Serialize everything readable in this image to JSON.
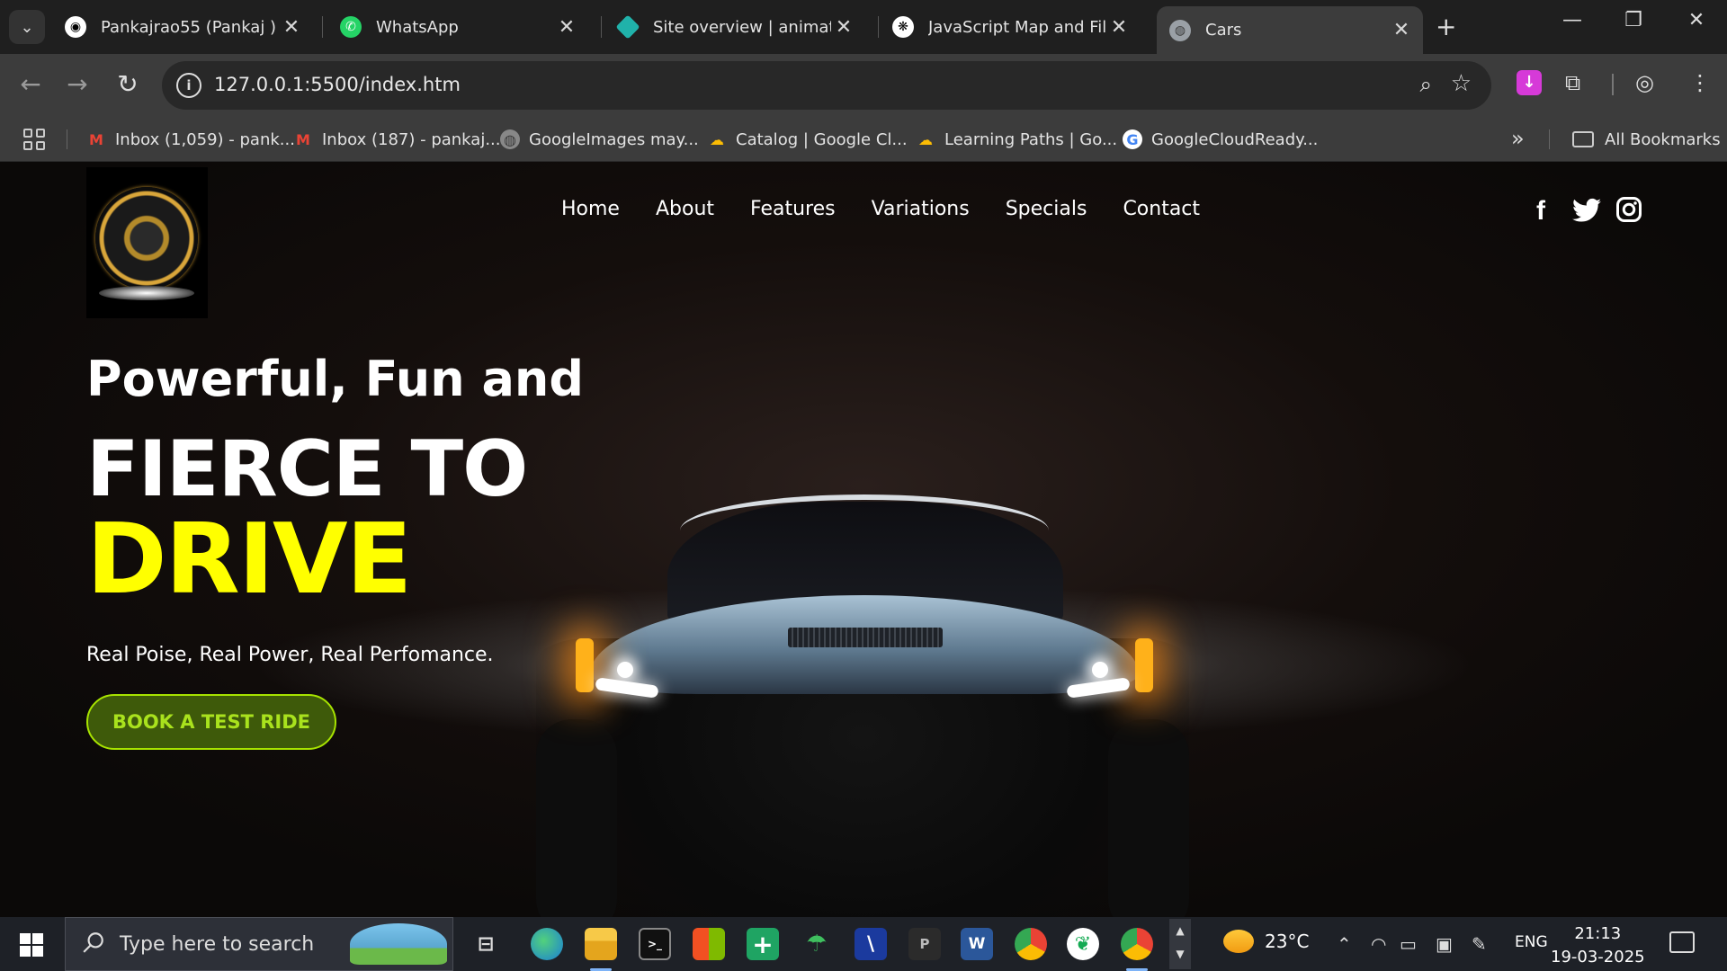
{
  "browser": {
    "tabs": [
      {
        "title": "Pankajrao55 (Pankaj )",
        "icon": "github-icon"
      },
      {
        "title": "WhatsApp",
        "icon": "whatsapp-icon"
      },
      {
        "title": "Site overview | animated-",
        "icon": "netlify-icon"
      },
      {
        "title": "JavaScript Map and Filter",
        "icon": "chatgpt-icon"
      },
      {
        "title": "Cars",
        "icon": "globe-icon",
        "active": true
      }
    ],
    "url": "127.0.0.1:5500/index.htm",
    "bookmarks": [
      {
        "label": "Inbox (1,059) - pank...",
        "icon": "gmail-icon"
      },
      {
        "label": "Inbox (187) - pankaj...",
        "icon": "gmail-icon"
      },
      {
        "label": "GoogleImages may...",
        "icon": "globe-icon"
      },
      {
        "label": "Catalog | Google Cl...",
        "icon": "google-cloud-icon"
      },
      {
        "label": "Learning Paths | Go...",
        "icon": "google-cloud-icon"
      },
      {
        "label": "GoogleCloudReady...",
        "icon": "google-icon"
      }
    ],
    "all_bookmarks": "All Bookmarks"
  },
  "site": {
    "nav": [
      "Home",
      "About",
      "Features",
      "Variations",
      "Specials",
      "Contact"
    ],
    "social": [
      "facebook-icon",
      "twitter-icon",
      "instagram-icon"
    ],
    "hero": {
      "line1": "Powerful, Fun and",
      "line2": "FIERCE TO",
      "line3": "DRIVE",
      "subtitle": "Real Poise, Real Power, Real Perfomance.",
      "cta": "BOOK A TEST RIDE"
    },
    "colors": {
      "accent": "#ffff00",
      "cta_bg": "#3e5a0a",
      "cta_text": "#a9e21d"
    }
  },
  "taskbar": {
    "search_placeholder": "Type here to search",
    "weather": "23°C",
    "language": "ENG",
    "time": "21:13",
    "date": "19-03-2025"
  }
}
